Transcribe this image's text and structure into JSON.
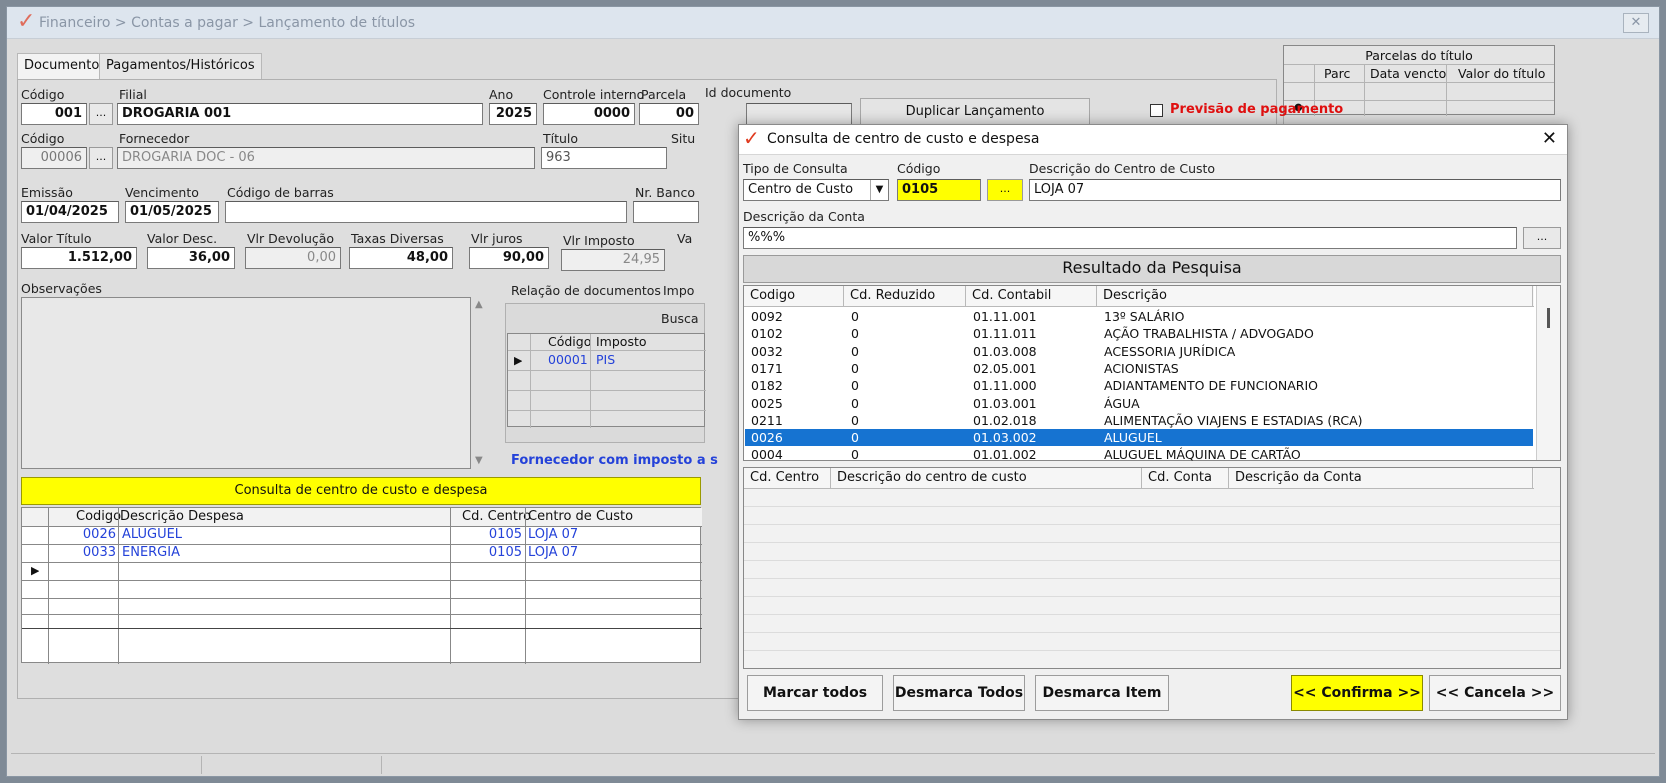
{
  "main": {
    "title": "Financeiro > Contas a pagar > Lançamento de títulos",
    "tabs": [
      "Documento",
      "Pagamentos/Históricos"
    ],
    "fields": {
      "codigo_label": "Código",
      "codigo": "001",
      "filial_label": "Filial",
      "filial": "DROGARIA 001",
      "ano_label": "Ano",
      "ano": "2025",
      "controle_label": "Controle interno",
      "controle": "0000",
      "parcela_label": "Parcela",
      "parcela": "00",
      "id_doc_label": "Id documento",
      "id_doc": "",
      "duplicar_label": "Duplicar Lançamento",
      "previsao_label": "Previsão de pagamento",
      "codigo2_label": "Código",
      "codigo2": "00006",
      "fornecedor_label": "Fornecedor",
      "fornecedor": "DROGARIA DOC - 06",
      "titulo_label": "Título",
      "titulo": "963",
      "situ_label": "Situ",
      "emissao_label": "Emissão",
      "emissao": "01/04/2025",
      "vencimento_label": "Vencimento",
      "vencimento": "01/05/2025",
      "barras_label": "Código de barras",
      "barras": "",
      "nrbanco_label": "Nr. Banco",
      "nrbanco": "",
      "valor_titulo_label": "Valor Título",
      "valor_titulo": "1.512,00",
      "valor_desc_label": "Valor Desc.",
      "valor_desc": "36,00",
      "vlr_devolucao_label": "Vlr Devolução",
      "vlr_devolucao": "0,00",
      "taxas_label": "Taxas Diversas",
      "taxas": "48,00",
      "vlr_juros_label": "Vlr juros",
      "vlr_juros": "90,00",
      "vlr_imposto_label": "Vlr Imposto",
      "vlr_imposto": "24,95",
      "va_label": "Va",
      "observacoes_label": "Observações"
    },
    "relacao_tab": "Relação de documentos",
    "impo_tab": "Impo",
    "busca_label": "Busca",
    "imposto_grid": {
      "headers": [
        "Código",
        "Imposto"
      ],
      "rows": [
        [
          "00001",
          "PIS"
        ]
      ]
    },
    "fornecedor_imposto_text": "Fornecedor com imposto a s",
    "consulta_banner": "Consulta de centro de custo e despesa",
    "despesa_grid": {
      "headers": [
        "Codigo",
        "Descrição Despesa",
        "Cd. Centro",
        "Centro de Custo"
      ],
      "rows": [
        [
          "0026",
          "ALUGUEL",
          "0105",
          "LOJA 07"
        ],
        [
          "0033",
          "ENERGIA",
          "0105",
          "LOJA 07"
        ]
      ]
    },
    "parcelas": {
      "title": "Parcelas do título",
      "headers": [
        "Parc",
        "Data vencto",
        "Valor do título"
      ]
    }
  },
  "dialog": {
    "title": "Consulta de centro de custo e despesa",
    "tipo_label": "Tipo de Consulta",
    "tipo_value": "Centro de Custo",
    "codigo_label": "Código",
    "codigo_value": "0105",
    "descricao_cc_label": "Descrição do Centro de Custo",
    "descricao_cc_value": "LOJA 07",
    "descricao_conta_label": "Descrição da Conta",
    "descricao_conta_value": "%%%",
    "ellipsis": "...",
    "resultado_title": "Resultado da Pesquisa",
    "result_headers": [
      "Codigo",
      "Cd. Reduzido",
      "Cd. Contabil",
      "Descrição"
    ],
    "results": [
      [
        "0092",
        "0",
        "01.11.001",
        "13º SALÁRIO"
      ],
      [
        "0102",
        "0",
        "01.11.011",
        "AÇÃO TRABALHISTA / ADVOGADO"
      ],
      [
        "0032",
        "0",
        "01.03.008",
        "ACESSORIA JURÍDICA"
      ],
      [
        "0171",
        "0",
        "02.05.001",
        "ACIONISTAS"
      ],
      [
        "0182",
        "0",
        "01.11.000",
        "ADIANTAMENTO DE FUNCIONARIO"
      ],
      [
        "0025",
        "0",
        "01.03.001",
        "ÁGUA"
      ],
      [
        "0211",
        "0",
        "01.02.018",
        "ALIMENTAÇÃO VIAJENS E ESTADIAS (RCA)"
      ],
      [
        "0026",
        "0",
        "01.03.002",
        "ALUGUEL"
      ],
      [
        "0004",
        "0",
        "01.01.002",
        "ALUGUEL MÁQUINA DE CARTÃO"
      ]
    ],
    "selected_index": 7,
    "lower_headers": [
      "Cd. Centro",
      "Descrição do centro de custo",
      "Cd. Conta",
      "Descrição da Conta"
    ],
    "buttons": {
      "marcar_todos": "Marcar todos",
      "desmarca_todos": "Desmarca Todos",
      "desmarca_item": "Desmarca Item",
      "confirma": "<< Confirma >>",
      "cancela": "<< Cancela >>"
    }
  },
  "colors": {
    "accent_yellow": "#ffff00",
    "selection_blue": "#1673d1",
    "link_blue": "#2442d9",
    "alert_red": "#e01010"
  }
}
